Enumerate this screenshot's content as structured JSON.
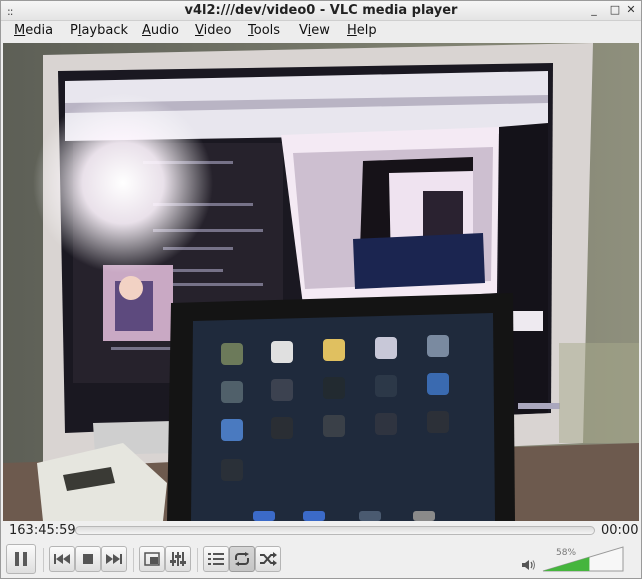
{
  "window": {
    "title": "v4l2:///dev/video0 - VLC media player",
    "grip_glyph": "::",
    "minimize_glyph": "_",
    "maximize_glyph": "□",
    "close_glyph": "✕"
  },
  "menu": {
    "items": [
      {
        "label": "Media",
        "mnemonic": "M"
      },
      {
        "label": "Playback",
        "mnemonic": "l"
      },
      {
        "label": "Audio",
        "mnemonic": "A"
      },
      {
        "label": "Video",
        "mnemonic": "V"
      },
      {
        "label": "Tools",
        "mnemonic": "T"
      },
      {
        "label": "View",
        "mnemonic": "i"
      },
      {
        "label": "Help",
        "mnemonic": "H"
      }
    ]
  },
  "seek": {
    "elapsed": "163:45:59",
    "total": "00:00",
    "progress": 0
  },
  "controls": {
    "buttons": [
      {
        "name": "pause-button",
        "icon": "pause-icon"
      },
      {
        "name": "previous-button",
        "icon": "skip-previous-icon"
      },
      {
        "name": "stop-button",
        "icon": "stop-icon"
      },
      {
        "name": "next-button",
        "icon": "skip-next-icon"
      },
      {
        "name": "fullscreen-button",
        "icon": "fullscreen-icon"
      },
      {
        "name": "extended-settings-button",
        "icon": "equalizer-icon"
      },
      {
        "name": "playlist-button",
        "icon": "playlist-icon"
      },
      {
        "name": "loop-button",
        "icon": "loop-icon"
      },
      {
        "name": "shuffle-button",
        "icon": "shuffle-icon"
      }
    ],
    "loop_active": true
  },
  "volume": {
    "label": "58%",
    "level": 0.58,
    "fill_color": "#45b53d",
    "icon": "speaker-icon"
  }
}
